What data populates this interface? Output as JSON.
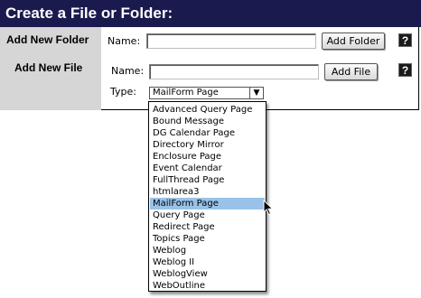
{
  "header": {
    "title": "Create a File or Folder:"
  },
  "folder_row": {
    "label": "Add New Folder",
    "name_label": "Name:",
    "name_value": "",
    "button_label": "Add Folder",
    "help_label": "?"
  },
  "file_row": {
    "label": "Add New File",
    "name_label": "Name:",
    "name_value": "",
    "button_label": "Add File",
    "help_label": "?",
    "type_label": "Type:",
    "type_selected": "MailForm Page",
    "arrow_glyph": "▼"
  },
  "type_options": [
    "Advanced Query Page",
    "Bound Message",
    "DG Calendar Page",
    "Directory Mirror",
    "Enclosure Page",
    "Event Calendar",
    "FullThread Page",
    "htmlarea3",
    "MailForm Page",
    "Query Page",
    "Redirect Page",
    "Topics Page",
    "Weblog",
    "Weblog II",
    "WeblogView",
    "WebOutline"
  ],
  "selected_index": 8,
  "icons": {
    "help": "help-icon",
    "cursor": "mouse-pointer-icon"
  }
}
